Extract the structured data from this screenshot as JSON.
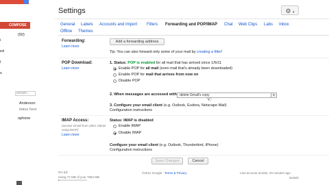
{
  "sidebar": {
    "compose": "COMPOSE",
    "items": [
      "(50)",
      "i",
      "ed",
      "l",
      "s"
    ],
    "search_placeholder": "people...",
    "contacts": [
      "Anderson",
      "itatus here",
      "ophone"
    ]
  },
  "header": {
    "title": "Settings",
    "gear_icon": "⚙",
    "gear_caret": "▾"
  },
  "tabs": [
    "General",
    "Labels",
    "Accounts and Import",
    "Filters",
    "Forwarding and POP/IMAP",
    "Chat",
    "Web Clips",
    "Labs",
    "Inbox",
    "Offline",
    "Themes"
  ],
  "forwarding": {
    "label": "Forwarding:",
    "learn_more": "Learn more",
    "button": "Add a forwarding address",
    "tip_prefix": "Tip: You can also forward only some of your mail by ",
    "tip_link": "creating a filter!"
  },
  "pop": {
    "label": "POP Download:",
    "learn_more": "Learn more",
    "status_prefix": "1. Status: ",
    "status_value": "POP is enabled",
    "status_suffix": " for all mail that has arrived since 1/6/11",
    "option1_prefix": "Enable POP for ",
    "option1_bold": "all mail",
    "option1_suffix": " (even mail that's already been downloaded)",
    "option2_prefix": "Enable POP for ",
    "option2_bold": "mail that arrives from now on",
    "option3": "Disable POP",
    "when_label": "2. When messages are accessed with POP",
    "when_select": "delete Gmail's copy",
    "configure_prefix": "3. Configure your email client",
    "configure_suffix": " (e.g. Outlook, Eudora, Netscape Mail)",
    "config_link": "Configuration instructions"
  },
  "imap": {
    "label": "IMAP Access:",
    "desc_line1": "(access Gmail from other clients",
    "desc_line2": "using IMAP)",
    "learn_more": "Learn more",
    "status": "Status: IMAP is disabled",
    "enable": "Enable IMAP",
    "disable": "Disable IMAP",
    "configure_prefix": "Configure your email client",
    "configure_suffix": " (e.g. Outlook, Thunderbird, iPhone)",
    "config_link": "Configuration instructions"
  },
  "actions": {
    "save": "Save Changes",
    "cancel": "Cancel"
  },
  "footer": {
    "usage_percent": "0% full",
    "usage_detail": "Using 74 MB of your 7684 MB",
    "usage_fraction": 0.01,
    "copyright_prefix": "©2012 Google - ",
    "terms": "Terms & Privacy",
    "activity": "Last account activity: 20 minutes ago",
    "details": "Details"
  }
}
